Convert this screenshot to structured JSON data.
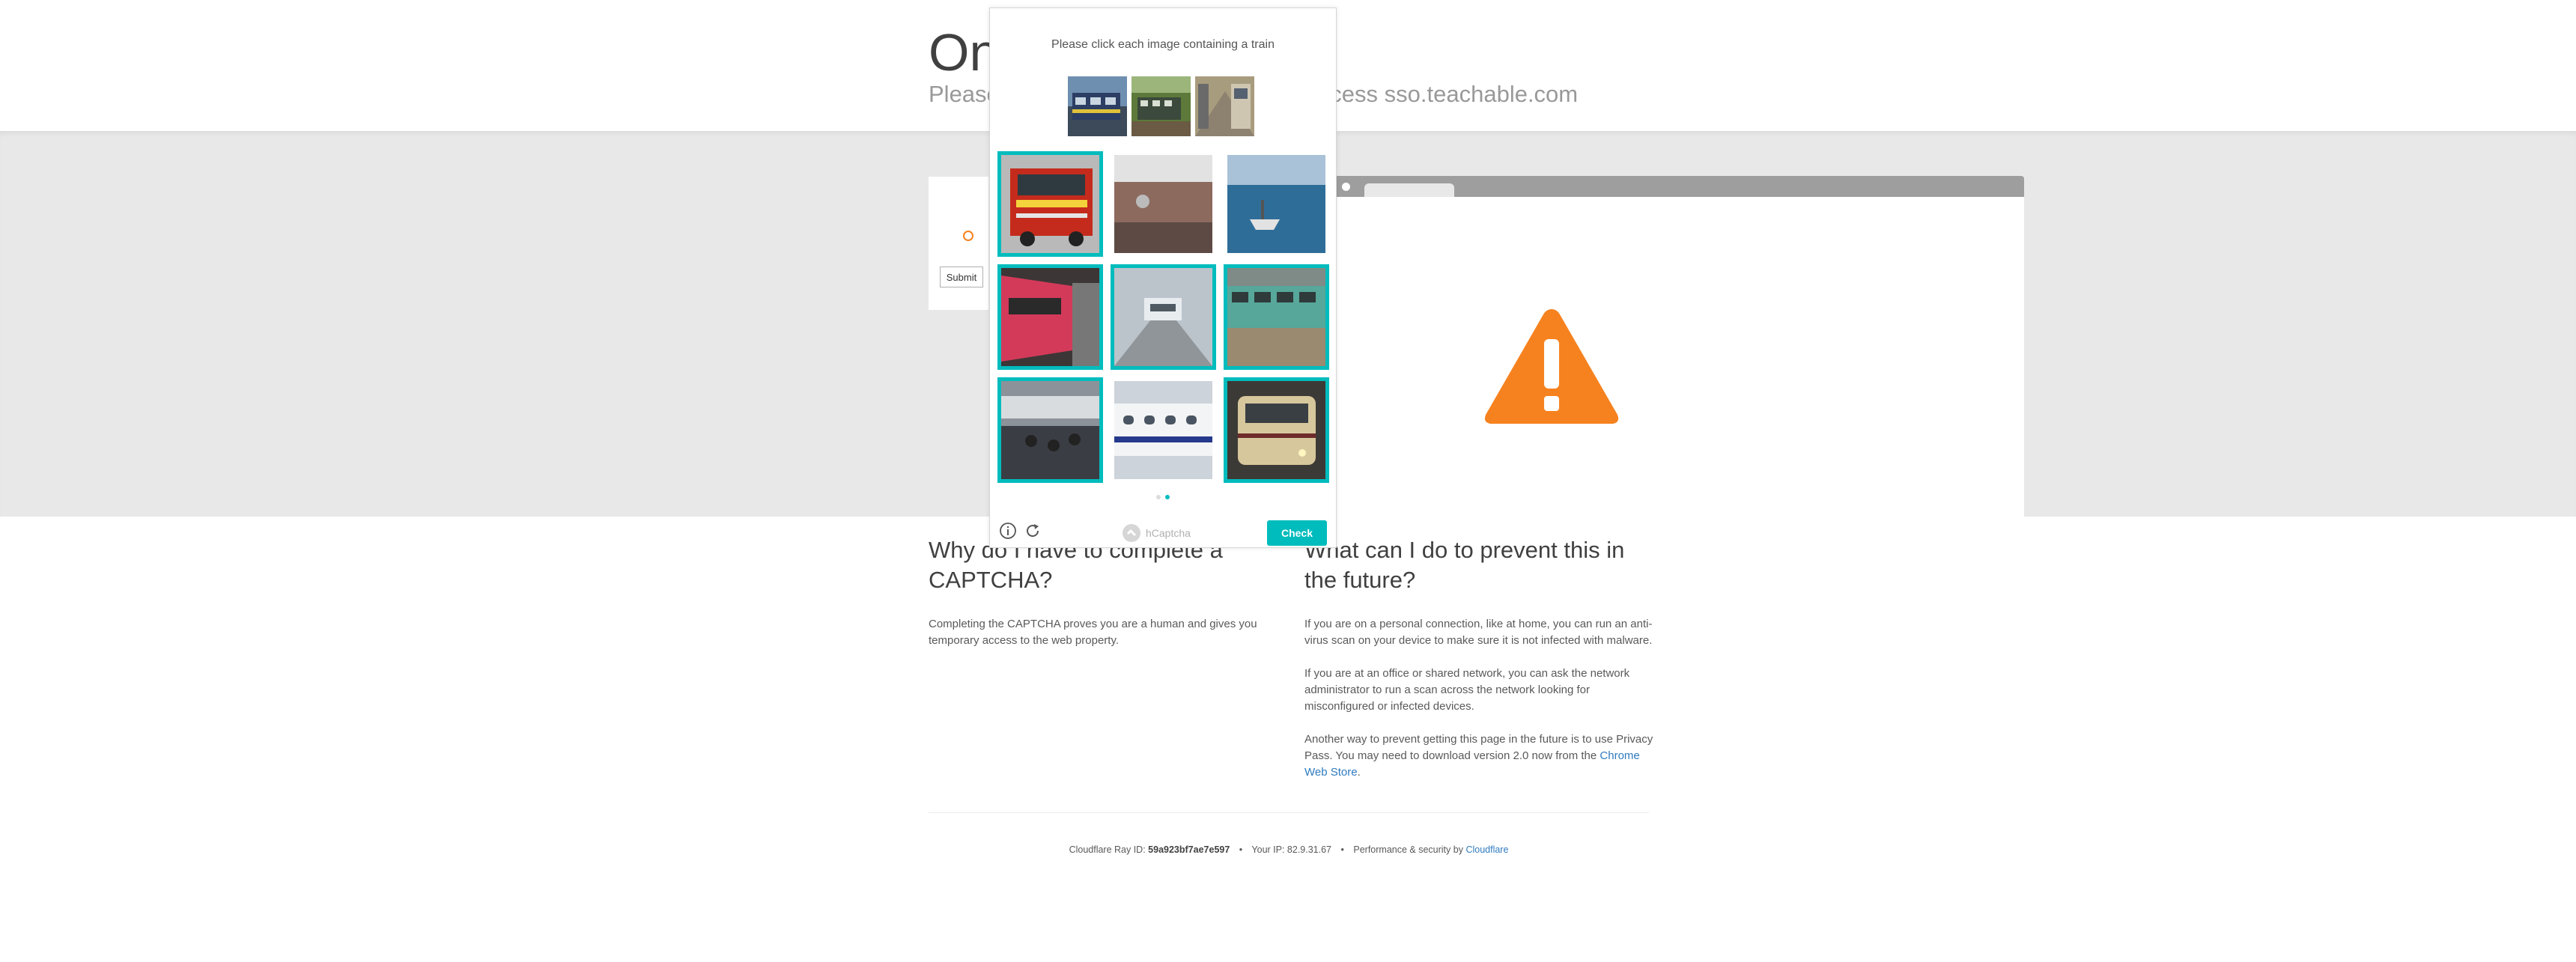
{
  "header": {
    "title": "On",
    "subtitle": "Please",
    "subtitle_tail": "ccess sso.teachable.com"
  },
  "form": {
    "submit_label": "Submit"
  },
  "captcha": {
    "prompt": "Please click each image containing a train",
    "brand": "hCaptcha",
    "check_label": "Check",
    "page_indicator": {
      "current": 2,
      "total": 2
    },
    "tiles": [
      {
        "subject": "fire-truck",
        "selected": true
      },
      {
        "subject": "brick-wall-street",
        "selected": false
      },
      {
        "subject": "boat-on-water",
        "selected": false
      },
      {
        "subject": "red-train",
        "selected": true
      },
      {
        "subject": "train-platform",
        "selected": true
      },
      {
        "subject": "green-train",
        "selected": true
      },
      {
        "subject": "station-interior",
        "selected": true
      },
      {
        "subject": "white-train-side",
        "selected": false
      },
      {
        "subject": "beige-train",
        "selected": true
      }
    ],
    "accent_color": "#00bcbd"
  },
  "why": {
    "heading": "Why do I have to complete a CAPTCHA?",
    "body": "Completing the CAPTCHA proves you are a human and gives you temporary access to the web property."
  },
  "prevent": {
    "heading": "What can I do to prevent this in the future?",
    "p1": "If you are on a personal connection, like at home, you can run an anti-virus scan on your device to make sure it is not infected with malware.",
    "p2": "If you are at an office or shared network, you can ask the network administrator to run a scan across the network looking for misconfigured or infected devices.",
    "p3_prefix": "Another way to prevent getting this page in the future is to use Privacy Pass. You may need to download version 2.0 now from the ",
    "p3_link": "Chrome Web Store",
    "p3_suffix": "."
  },
  "footer": {
    "ray_label": "Cloudflare Ray ID: ",
    "ray_id": "59a923bf7ae7e597",
    "ip_label": "Your IP: ",
    "ip": "82.9.31.67",
    "perf_label": "Performance & security by ",
    "cloudflare": "Cloudflare",
    "separator": "•"
  },
  "colors": {
    "warning": "#f6821f",
    "link": "#2f7bbf"
  },
  "icons": [
    "warning-icon",
    "info-icon",
    "refresh-icon",
    "hcaptcha-logo-icon"
  ]
}
